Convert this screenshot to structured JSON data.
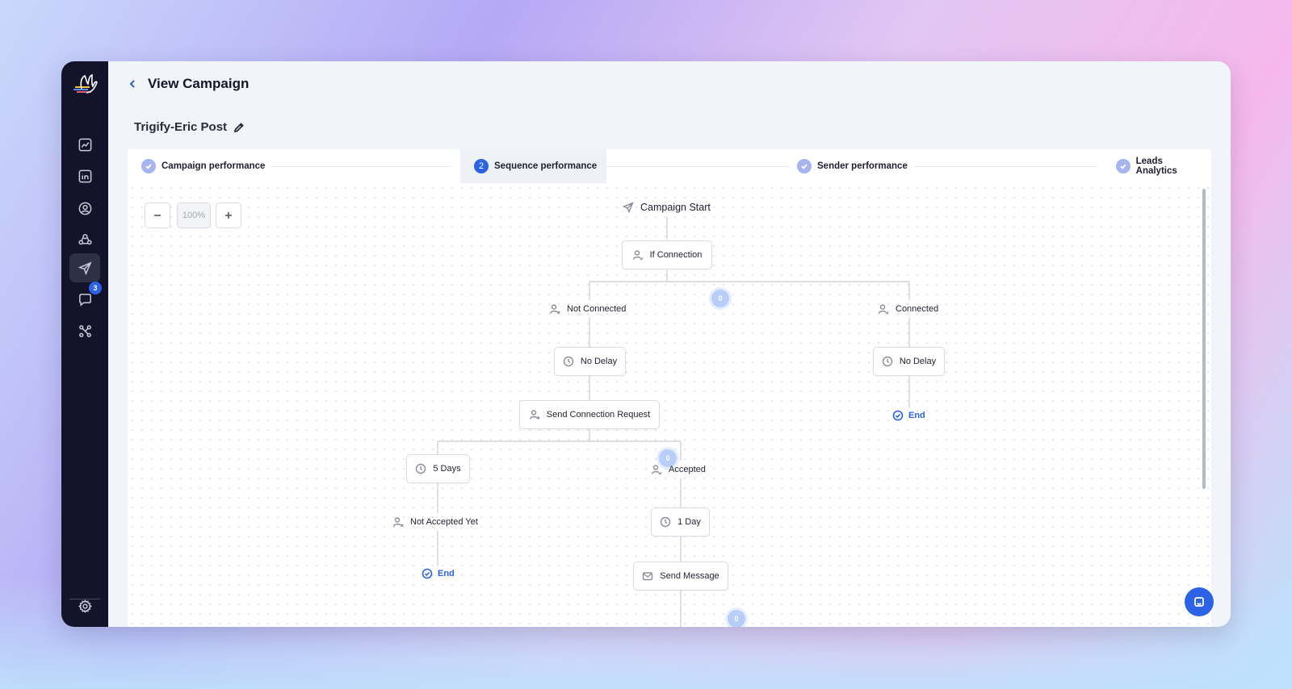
{
  "header": {
    "title": "View Campaign"
  },
  "campaign": {
    "name": "Trigify-Eric Post"
  },
  "tabs": [
    {
      "label": "Campaign performance",
      "state": "completed"
    },
    {
      "label": "Sequence performance",
      "state": "active",
      "number": "2"
    },
    {
      "label": "Sender performance",
      "state": "completed"
    },
    {
      "label": "Leads Analytics",
      "state": "completed"
    }
  ],
  "zoom": {
    "level": "100%"
  },
  "sidebar": {
    "items": [
      {
        "icon": "chart-icon"
      },
      {
        "icon": "linkedin-icon"
      },
      {
        "icon": "user-circle-icon"
      },
      {
        "icon": "team-icon"
      },
      {
        "icon": "send-icon",
        "active": true
      },
      {
        "icon": "chat-icon",
        "badge": "3"
      },
      {
        "icon": "integrations-icon"
      }
    ],
    "settings_icon": "gear-icon"
  },
  "flow": {
    "start": "Campaign Start",
    "if_connection": "If Connection",
    "not_connected": "Not Connected",
    "connected": "Connected",
    "no_delay_left": "No Delay",
    "no_delay_right": "No Delay",
    "send_connection_request": "Send Connection Request",
    "end_right": "End",
    "five_days": "5 Days",
    "accepted": "Accepted",
    "not_accepted_yet": "Not Accepted Yet",
    "one_day": "1 Day",
    "end_left": "End",
    "send_message": "Send Message",
    "counts": {
      "if_connection": "0",
      "send_connection_request": "0",
      "send_message": "0"
    }
  },
  "colors": {
    "accent": "#2c63e6",
    "sidebar": "#13142b",
    "tab_check": "#a6b4f0",
    "count_bubble": "#b8cef8"
  }
}
